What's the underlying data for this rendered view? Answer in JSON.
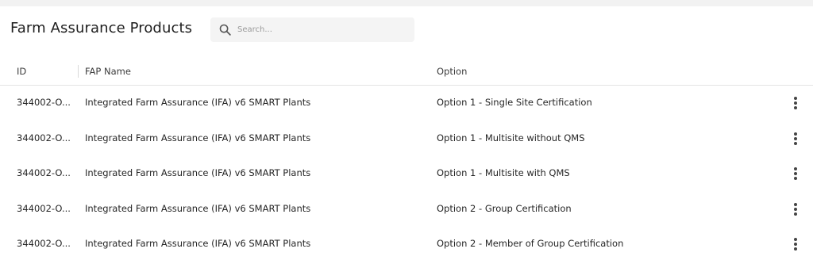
{
  "header": {
    "title": "Farm Assurance Products",
    "search": {
      "placeholder": "Search...",
      "value": "",
      "icon": "search-icon"
    }
  },
  "table": {
    "columns": [
      "ID",
      "FAP Name",
      "Option"
    ],
    "rows": [
      {
        "id": "344002-O...",
        "name": "Integrated Farm Assurance (IFA) v6 SMART Plants",
        "option": "Option 1 - Single Site Certification"
      },
      {
        "id": "344002-O...",
        "name": "Integrated Farm Assurance (IFA) v6 SMART Plants",
        "option": "Option 1 - Multisite without QMS"
      },
      {
        "id": "344002-O...",
        "name": "Integrated Farm Assurance (IFA) v6 SMART Plants",
        "option": "Option 1 - Multisite with QMS"
      },
      {
        "id": "344002-O...",
        "name": "Integrated Farm Assurance (IFA) v6 SMART Plants",
        "option": "Option 2 - Group Certification"
      },
      {
        "id": "344002-O...",
        "name": "Integrated Farm Assurance (IFA) v6 SMART Plants",
        "option": "Option 2 - Member of Group Certification"
      }
    ],
    "row_action_icon": "more-vertical-icon"
  }
}
